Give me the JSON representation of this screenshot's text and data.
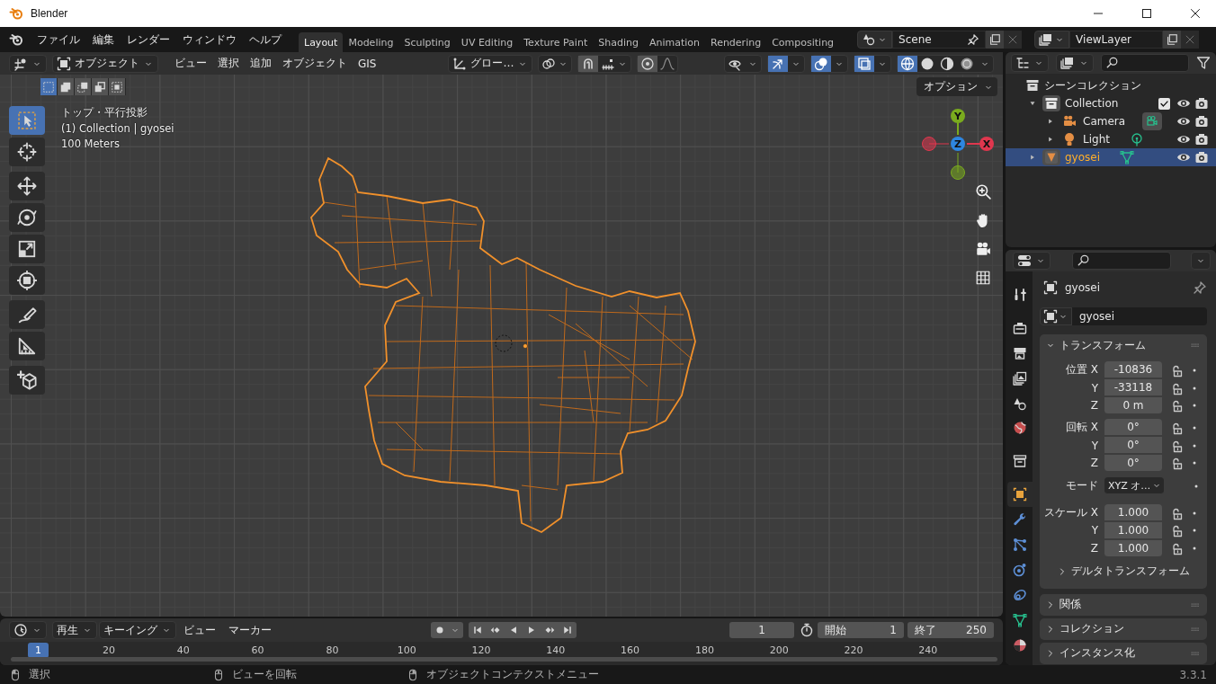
{
  "window": {
    "title": "Blender"
  },
  "menu": [
    "ファイル",
    "編集",
    "レンダー",
    "ウィンドウ",
    "ヘルプ"
  ],
  "workspaces": [
    {
      "label": "Layout",
      "selected": true
    },
    {
      "label": "Modeling",
      "selected": false
    },
    {
      "label": "Sculpting",
      "selected": false
    },
    {
      "label": "UV Editing",
      "selected": false
    },
    {
      "label": "Texture Paint",
      "selected": false
    },
    {
      "label": "Shading",
      "selected": false
    },
    {
      "label": "Animation",
      "selected": false
    },
    {
      "label": "Rendering",
      "selected": false
    },
    {
      "label": "Compositing",
      "selected": false
    }
  ],
  "scene": "Scene",
  "view_layer": "ViewLayer",
  "viewport": {
    "mode": "オブジェクト",
    "menus": [
      "ビュー",
      "選択",
      "追加",
      "オブジェクト",
      "GIS"
    ],
    "orientation": "グロー…",
    "select_modes": [
      {
        "selected": true
      },
      {
        "selected": false
      },
      {
        "selected": false
      },
      {
        "selected": false
      },
      {
        "selected": false
      }
    ],
    "toggles": [
      {
        "kind": "visibility",
        "selected": false
      },
      {
        "kind": "gizmo",
        "selected": true
      },
      {
        "kind": "overlay",
        "selected": true
      },
      {
        "kind": "xray",
        "selected": true
      }
    ],
    "shading_modes": [
      {
        "kind": "wireframe",
        "selected": true
      },
      {
        "kind": "solid",
        "selected": false
      },
      {
        "kind": "material",
        "selected": false
      },
      {
        "kind": "rendered",
        "selected": false
      }
    ],
    "options": "オプション",
    "info": [
      "トップ・平行投影",
      "(1) Collection | gyosei",
      "100 Meters"
    ],
    "tool_groups": [
      [
        {
          "kind": "select",
          "selected": true
        },
        {
          "kind": "cursor",
          "selected": false
        }
      ],
      [
        {
          "kind": "move",
          "selected": false
        },
        {
          "kind": "rotate",
          "selected": false
        },
        {
          "kind": "scale",
          "selected": false
        },
        {
          "kind": "transform",
          "selected": false
        }
      ],
      [
        {
          "kind": "annotate",
          "selected": false
        },
        {
          "kind": "measure",
          "selected": false
        }
      ],
      [
        {
          "kind": "add-cube",
          "selected": false
        }
      ]
    ],
    "axes": [
      {
        "label": "Y",
        "color": "#7aab1e"
      },
      {
        "label": "Z",
        "color": "#2e86e0"
      },
      {
        "label": "X",
        "color": "#e0374e"
      }
    ]
  },
  "outliner": {
    "root": "シーンコレクション",
    "items": [
      {
        "label": "Collection",
        "kind": "collection",
        "expanded": true,
        "checked": true,
        "selected": false,
        "children": [
          {
            "label": "Camera",
            "kind": "camera",
            "expanded": false,
            "selected": false
          },
          {
            "label": "Light",
            "kind": "light",
            "expanded": false,
            "selected": false
          }
        ]
      },
      {
        "label": "gyosei",
        "kind": "mesh",
        "expanded": false,
        "selected": true
      }
    ]
  },
  "properties": {
    "tabs": [
      {
        "kind": "tool",
        "selected": false
      },
      {
        "kind": "render",
        "selected": false
      },
      {
        "kind": "output",
        "selected": false
      },
      {
        "kind": "view-layer",
        "selected": false
      },
      {
        "kind": "scene",
        "selected": false
      },
      {
        "kind": "world",
        "selected": false
      },
      {
        "kind": "collection",
        "selected": false
      },
      {
        "kind": "object",
        "selected": true
      },
      {
        "kind": "modifier",
        "selected": false
      },
      {
        "kind": "particles",
        "selected": false
      },
      {
        "kind": "physics",
        "selected": false
      },
      {
        "kind": "constraints",
        "selected": false
      },
      {
        "kind": "data",
        "selected": false
      },
      {
        "kind": "material",
        "selected": false
      }
    ],
    "object_name": "gyosei",
    "data_name": "gyosei",
    "transform": {
      "title": "トランスフォーム",
      "expanded": true,
      "groups": [
        {
          "rows": [
            {
              "label": "位置 X",
              "value": "-10836",
              "kind": "number"
            },
            {
              "label": "Y",
              "value": "-33118",
              "kind": "number"
            },
            {
              "label": "Z",
              "value": "0 m",
              "kind": "number"
            }
          ]
        },
        {
          "rows": [
            {
              "label": "回転 X",
              "value": "0°",
              "kind": "number"
            },
            {
              "label": "Y",
              "value": "0°",
              "kind": "number"
            },
            {
              "label": "Z",
              "value": "0°",
              "kind": "number"
            }
          ]
        },
        {
          "rows": [
            {
              "label": "モード",
              "value": "XYZ オ…",
              "kind": "dropdown"
            }
          ]
        },
        {
          "rows": [
            {
              "label": "スケール X",
              "value": "1.000",
              "kind": "number"
            },
            {
              "label": "Y",
              "value": "1.000",
              "kind": "number"
            },
            {
              "label": "Z",
              "value": "1.000",
              "kind": "number"
            }
          ]
        }
      ],
      "subpanel": {
        "title": "デルタトランスフォーム",
        "expanded": false
      }
    },
    "panels": [
      {
        "title": "関係",
        "expanded": false
      },
      {
        "title": "コレクション",
        "expanded": false
      },
      {
        "title": "インスタンス化",
        "expanded": false
      }
    ]
  },
  "timeline": {
    "menus": [
      {
        "label": "再生",
        "kind": "dropdown"
      },
      {
        "label": "キーイング",
        "kind": "dropdown"
      },
      {
        "label": "ビュー",
        "kind": "menu"
      },
      {
        "label": "マーカー",
        "kind": "menu"
      }
    ],
    "current_frame": "1",
    "start_label": "開始",
    "start": "1",
    "end_label": "終了",
    "end": "250",
    "marker": "1",
    "ticks": [
      "20",
      "40",
      "60",
      "80",
      "100",
      "120",
      "140",
      "160",
      "180",
      "200",
      "220",
      "240"
    ]
  },
  "status_bar": {
    "items": [
      {
        "kind": "left-click",
        "text": "選択"
      },
      {
        "kind": "middle-click",
        "text": "ビューを回転"
      },
      {
        "kind": "right-click",
        "text": "オブジェクトコンテクストメニュー"
      }
    ],
    "version": "3.3.1"
  }
}
